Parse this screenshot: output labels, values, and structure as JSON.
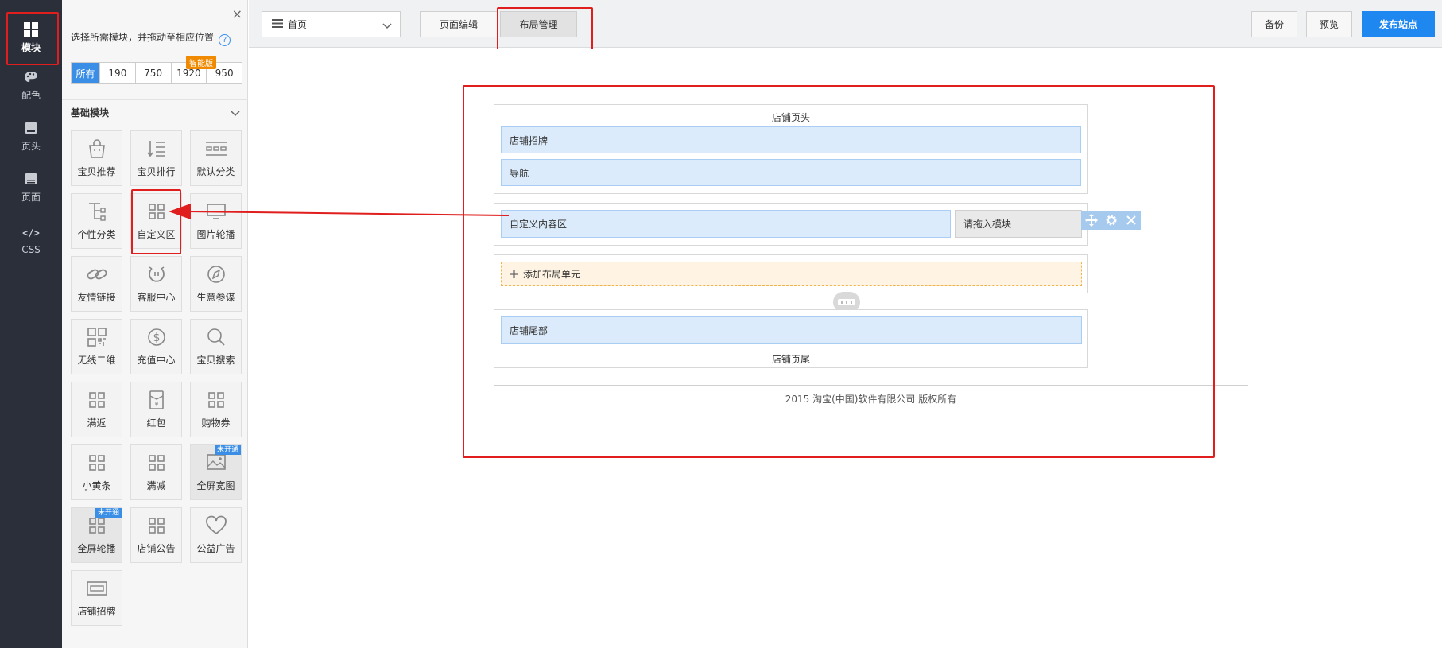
{
  "leftnav": {
    "items": [
      {
        "label": "模块",
        "icon": "grid-icon"
      },
      {
        "label": "配色",
        "icon": "palette-icon"
      },
      {
        "label": "页头",
        "icon": "header-icon"
      },
      {
        "label": "页面",
        "icon": "page-icon"
      },
      {
        "label": "CSS",
        "icon": "code-icon",
        "glyph": "</>"
      }
    ]
  },
  "panel": {
    "close": "×",
    "tip": "选择所需模块，并拖动至相应位置",
    "help": "?",
    "filters": [
      "所有",
      "190",
      "750",
      "1920",
      "950"
    ],
    "smart_badge": "智能版",
    "section_title": "基础模块",
    "modules": [
      {
        "label": "宝贝推荐",
        "icon": "bag-icon"
      },
      {
        "label": "宝贝排行",
        "icon": "rank-list-icon"
      },
      {
        "label": "默认分类",
        "icon": "category-icon"
      },
      {
        "label": "个性分类",
        "icon": "tree-icon"
      },
      {
        "label": "自定义区",
        "icon": "grid-icon"
      },
      {
        "label": "图片轮播",
        "icon": "monitor-icon"
      },
      {
        "label": "友情链接",
        "icon": "link-icon"
      },
      {
        "label": "客服中心",
        "icon": "service-icon"
      },
      {
        "label": "生意参谋",
        "icon": "compass-icon"
      },
      {
        "label": "无线二维",
        "icon": "qrcode-icon"
      },
      {
        "label": "充值中心",
        "icon": "dollar-icon"
      },
      {
        "label": "宝贝搜索",
        "icon": "search-icon"
      },
      {
        "label": "满返",
        "icon": "grid-icon"
      },
      {
        "label": "红包",
        "icon": "red-packet-icon"
      },
      {
        "label": "购物券",
        "icon": "grid-icon"
      },
      {
        "label": "小黄条",
        "icon": "grid-icon"
      },
      {
        "label": "满减",
        "icon": "grid-icon"
      },
      {
        "label": "全屏宽图",
        "icon": "image-icon",
        "tag": "未开通"
      },
      {
        "label": "全屏轮播",
        "icon": "grid-icon",
        "tag": "未开通"
      },
      {
        "label": "店铺公告",
        "icon": "grid-icon"
      },
      {
        "label": "公益广告",
        "icon": "heart-icon"
      },
      {
        "label": "店铺招牌",
        "icon": "banner-icon"
      }
    ]
  },
  "topbar": {
    "page_select": "首页",
    "tab_edit": "页面编辑",
    "tab_layout": "布局管理",
    "backup": "备份",
    "preview": "预览",
    "publish": "发布站点"
  },
  "canvas": {
    "header_title": "店铺页头",
    "header_modules": [
      "店铺招牌",
      "导航"
    ],
    "custom_area": "自定义内容区",
    "drop_hint": "请拖入模块",
    "add_unit": "添加布局单元",
    "footer_module": "店铺尾部",
    "footer_title": "店铺页尾",
    "copyright": "2015 淘宝(中国)软件有限公司 版权所有"
  },
  "colors": {
    "accent": "#1f87f0",
    "highlight": "#e01e1e",
    "module_blue": "#dcebfb"
  }
}
